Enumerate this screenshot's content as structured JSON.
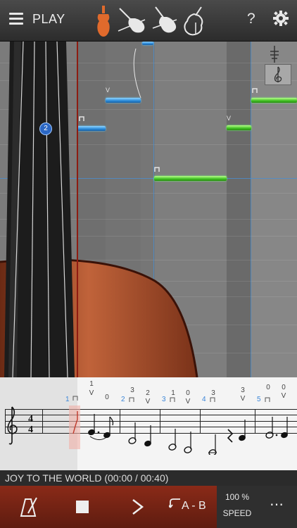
{
  "header": {
    "mode_label": "PLAY",
    "help_label": "?"
  },
  "instruments": [
    "violin-icon",
    "viola-icon",
    "cello-icon",
    "bass-icon"
  ],
  "roll": {
    "finger_badge": "2",
    "bow_marks": [
      "V",
      "V",
      "V"
    ]
  },
  "score": {
    "measure_numbers": [
      "1",
      "2",
      "3",
      "4",
      "5"
    ],
    "fingerings": [
      "1",
      "0",
      "3",
      "2",
      "1",
      "0",
      "3",
      "3",
      "0",
      "0"
    ],
    "bow_letters": [
      "V",
      "V",
      "V",
      "V",
      "V"
    ]
  },
  "status": {
    "song_text": "JOY TO THE WORLD (00:00 / 00:40)"
  },
  "toolbar": {
    "ab_label": "A - B",
    "speed_value": "100 %",
    "speed_label": "SPEED",
    "more_label": "⋯"
  },
  "colors": {
    "accent": "#8a2a18",
    "note_blue": "#2a89d8",
    "note_green": "#3fbf22"
  }
}
